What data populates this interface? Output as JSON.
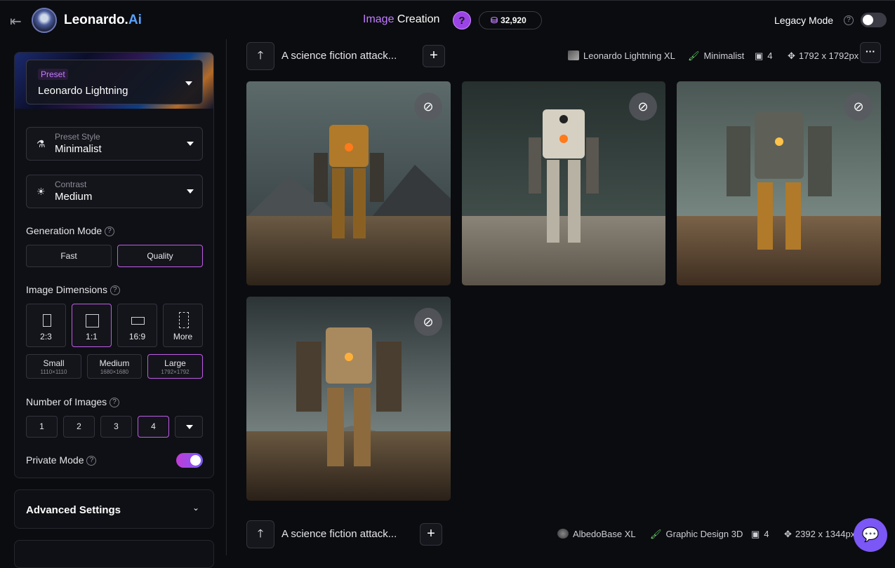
{
  "header": {
    "brand_name": "Leonardo.",
    "brand_suffix": "Ai",
    "title_highlight": "Image",
    "title_rest": " Creation",
    "help_label": "?",
    "token_count": "32,920",
    "legacy_label": "Legacy Mode",
    "legacy_enabled": false
  },
  "sidebar": {
    "preset_tag": "Preset",
    "preset_value": "Leonardo Lightning",
    "preset_style_label": "Preset Style",
    "preset_style_value": "Minimalist",
    "contrast_label": "Contrast",
    "contrast_value": "Medium",
    "generation_mode_label": "Generation Mode",
    "generation_modes": [
      "Fast",
      "Quality"
    ],
    "generation_mode_selected": "Quality",
    "image_dimensions_label": "Image Dimensions",
    "aspect_ratios": [
      "2:3",
      "1:1",
      "16:9",
      "More"
    ],
    "aspect_selected": "1:1",
    "sizes": [
      {
        "label": "Small",
        "dims": "1110×1110"
      },
      {
        "label": "Medium",
        "dims": "1680×1680"
      },
      {
        "label": "Large",
        "dims": "1792×1792"
      }
    ],
    "size_selected": "Large",
    "num_images_label": "Number of Images",
    "num_images_options": [
      "1",
      "2",
      "3",
      "4"
    ],
    "num_images_selected": "4",
    "private_mode_label": "Private Mode",
    "private_mode_enabled": true
  },
  "advanced": {
    "label": "Advanced Settings"
  },
  "generations": [
    {
      "prompt": "A science fiction attack...",
      "model": "Leonardo Lightning XL",
      "style": "Minimalist",
      "count": "4",
      "dimensions": "1792 x 1792px"
    },
    {
      "prompt": "A science fiction attack...",
      "model": "AlbedoBase XL",
      "style": "Graphic Design 3D",
      "count": "4",
      "dimensions": "2392 x 1344px"
    }
  ],
  "colors": {
    "accent": "#c05be8",
    "background": "#0b0c10",
    "panel": "#0f1015"
  },
  "icons": {
    "back": "back-arrow-icon",
    "hide": "eye-off-icon",
    "chat": "chat-icon"
  }
}
